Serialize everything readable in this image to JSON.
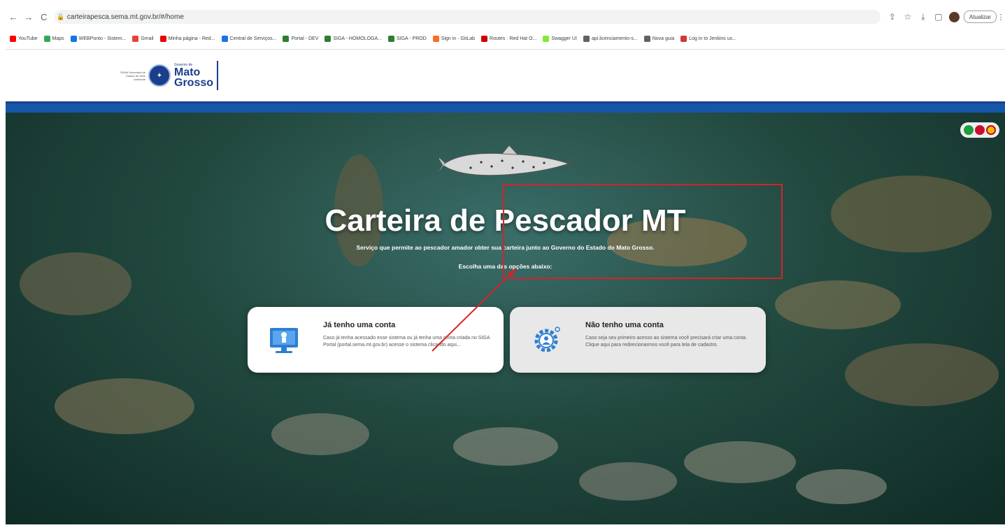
{
  "browser": {
    "url": "carteirapesca.sema.mt.gov.br/#/home",
    "update_label": "Atualizar",
    "bookmarks": [
      {
        "label": "YouTube",
        "color": "#ff0000"
      },
      {
        "label": "Maps",
        "color": "#34a853"
      },
      {
        "label": "WEBPonto - Sistem...",
        "color": "#1a73e8"
      },
      {
        "label": "Gmail",
        "color": "#ea4335"
      },
      {
        "label": "Minha página - Red...",
        "color": "#e60000"
      },
      {
        "label": "Central de Serviços...",
        "color": "#1a73e8"
      },
      {
        "label": "Portal - DEV",
        "color": "#2e7d32"
      },
      {
        "label": "SIGA - HOMOLOGA...",
        "color": "#2e7d32"
      },
      {
        "label": "SIGA - PROD",
        "color": "#2e7d32"
      },
      {
        "label": "Sign in · GitLab",
        "color": "#fc6d26"
      },
      {
        "label": "Routes · Red Hat O...",
        "color": "#cc0000"
      },
      {
        "label": "Swagger UI",
        "color": "#85ea2d"
      },
      {
        "label": "api.licenciamento-s...",
        "color": "#5f6368"
      },
      {
        "label": "Nova guia",
        "color": "#5f6368"
      },
      {
        "label": "Log in to Jenkins us...",
        "color": "#d33833"
      }
    ]
  },
  "header": {
    "logo_small": "SEMA Secretaria de Estado de Meio Ambiente",
    "logo_gov": "Governo de",
    "logo_line1": "Mato",
    "logo_line2": "Grosso"
  },
  "hero": {
    "title": "Carteira de Pescador MT",
    "subtitle": "Serviço que permite ao pescador amador obter sua carteira junto ao Governo do Estado do Mato Grosso.",
    "choose": "Escolha uma das opções abaixo:"
  },
  "cards": {
    "has_account": {
      "title": "Já tenho uma conta",
      "description": "Caso já tenha acessado esse sistema ou já tenha uma conta criada no SIGA Portal (portal.sema.mt.gov.br) acesse o sistema clicando aqui..."
    },
    "no_account": {
      "title": "Não tenho uma conta",
      "description": "Caso seja seu primeiro acesso ao sistema você precisará criar uma conta. Clique aqui para redirecionarmos você para tela de cadastro."
    }
  },
  "colors": {
    "header_band": "#1656a8",
    "highlight": "#d4232a",
    "logo_blue": "#1a3e8c"
  }
}
